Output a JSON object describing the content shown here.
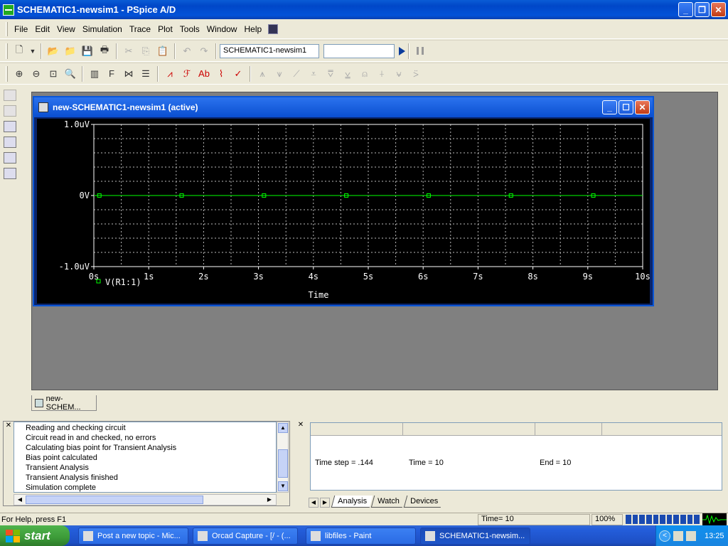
{
  "window": {
    "title": "SCHEMATIC1-newsim1 - PSpice A/D",
    "buttons": [
      "_",
      "❐",
      "✕"
    ]
  },
  "menu": [
    {
      "label": "File",
      "key": "F"
    },
    {
      "label": "Edit",
      "key": "E"
    },
    {
      "label": "View",
      "key": "V"
    },
    {
      "label": "Simulation",
      "key": "S"
    },
    {
      "label": "Trace",
      "key": "T"
    },
    {
      "label": "Plot",
      "key": "P"
    },
    {
      "label": "Tools",
      "key": "o"
    },
    {
      "label": "Window",
      "key": "W"
    },
    {
      "label": "Help",
      "key": "H"
    }
  ],
  "toolbar": {
    "profile_combo": "SCHEMATIC1-newsim1",
    "second_combo": ""
  },
  "plot_window": {
    "title": "new-SCHEMATIC1-newsim1 (active)",
    "xlabel": "Time",
    "legend": "V(R1:1)"
  },
  "chart_data": {
    "type": "line",
    "background": "#000000",
    "grid": true,
    "xlabel": "Time",
    "xlim": [
      0,
      10
    ],
    "ylim": [
      -1.0,
      1.0
    ],
    "x_ticks": [
      "0s",
      "1s",
      "2s",
      "3s",
      "4s",
      "5s",
      "6s",
      "7s",
      "8s",
      "9s",
      "10s"
    ],
    "y_ticks": [
      {
        "value": 1.0,
        "label": "1.0uV"
      },
      {
        "value": 0,
        "label": "0V"
      },
      {
        "value": -1.0,
        "label": "-1.0uV"
      }
    ],
    "series": [
      {
        "name": "V(R1:1)",
        "color": "#00ff00",
        "marker": "square",
        "x": [
          0,
          10
        ],
        "y": [
          0,
          0
        ],
        "marker_x": [
          0.1,
          1.6,
          3.1,
          4.6,
          6.1,
          7.6,
          9.1
        ]
      }
    ]
  },
  "doc_tab": "new-SCHEM...",
  "output_log": [
    "Reading and checking circuit",
    "Circuit read in and checked, no errors",
    "Calculating bias point for Transient Analysis",
    "Bias point calculated",
    "Transient Analysis",
    "Transient Analysis finished",
    "Simulation complete"
  ],
  "sim_status": {
    "time_step": "Time step = .144",
    "time": "Time = 10",
    "end": "End = 10",
    "tabs": [
      "Analysis",
      "Watch",
      "Devices"
    ]
  },
  "statusbar": {
    "help": "For Help, press F1",
    "time": "Time= 10",
    "zoom": "100%"
  },
  "taskbar": {
    "start": "start",
    "tasks": [
      "Post a new topic - Mic...",
      "Orcad Capture - [/ - (...",
      "libfiles - Paint",
      "SCHEMATIC1-newsim..."
    ],
    "clock": "13:25"
  }
}
